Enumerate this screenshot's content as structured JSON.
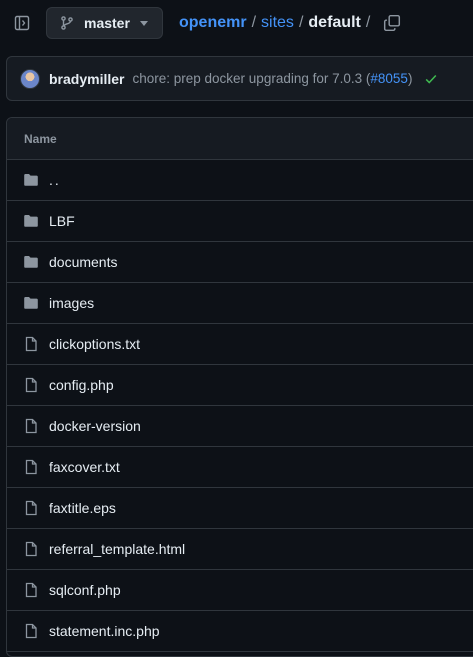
{
  "toolbar": {
    "sidebar_icon": "sidebar-expand-icon",
    "branch": "master"
  },
  "breadcrumb": {
    "repo": "openemr",
    "folder": "sites",
    "current": "default",
    "separator": "/"
  },
  "commit": {
    "author": "bradymiller",
    "message_prefix": "chore: prep docker upgrading for 7.0.3 (",
    "pr": "#8055",
    "message_suffix": ")",
    "status": "success",
    "status_color": "#3fb950"
  },
  "table": {
    "header": "Name",
    "rows": [
      {
        "name": "..",
        "type": "parent"
      },
      {
        "name": "LBF",
        "type": "folder"
      },
      {
        "name": "documents",
        "type": "folder"
      },
      {
        "name": "images",
        "type": "folder"
      },
      {
        "name": "clickoptions.txt",
        "type": "file"
      },
      {
        "name": "config.php",
        "type": "file"
      },
      {
        "name": "docker-version",
        "type": "file"
      },
      {
        "name": "faxcover.txt",
        "type": "file"
      },
      {
        "name": "faxtitle.eps",
        "type": "file"
      },
      {
        "name": "referral_template.html",
        "type": "file"
      },
      {
        "name": "sqlconf.php",
        "type": "file"
      },
      {
        "name": "statement.inc.php",
        "type": "file"
      }
    ]
  },
  "colors": {
    "background": "#0d1117",
    "link": "#4493f8",
    "border": "#30363d",
    "muted": "#8d96a0"
  }
}
